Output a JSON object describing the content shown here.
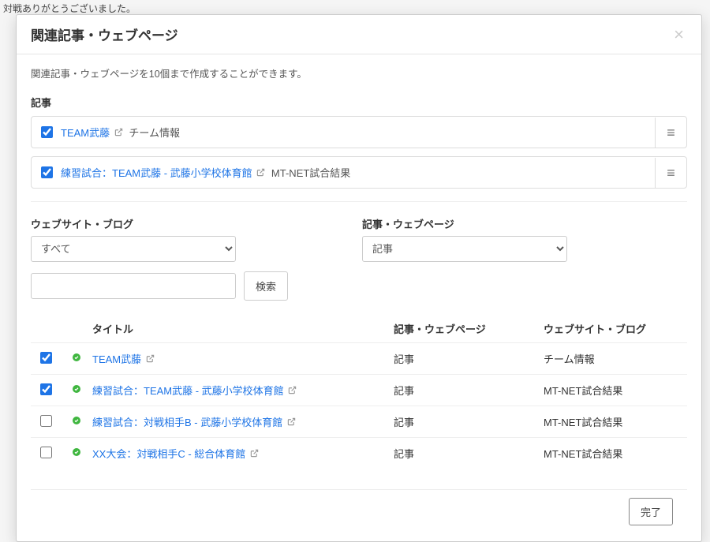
{
  "background": {
    "partial_text": "対戦ありがとうございました。"
  },
  "modal": {
    "title": "関連記事・ウェブページ",
    "close_aria": "Close",
    "intro": "関連記事・ウェブページを10個まで作成することができます。",
    "selected_label": "記事",
    "selected_items": [
      {
        "checked": true,
        "link": "TEAM武藤",
        "has_ext": true,
        "site": "チーム情報"
      },
      {
        "checked": true,
        "link": "練習試合：TEAM武藤 - 武藤小学校体育館",
        "has_ext": true,
        "site": "MT-NET試合結果"
      }
    ],
    "filters": {
      "website_label": "ウェブサイト・ブログ",
      "website_value": "すべて",
      "type_label": "記事・ウェブページ",
      "type_value": "記事"
    },
    "search": {
      "placeholder": "",
      "button": "検索"
    },
    "table": {
      "head": {
        "title": "タイトル",
        "type": "記事・ウェブページ",
        "site": "ウェブサイト・ブログ"
      },
      "rows": [
        {
          "checked": true,
          "status": "published",
          "title": "TEAM武藤",
          "has_ext": true,
          "type": "記事",
          "site": "チーム情報"
        },
        {
          "checked": true,
          "status": "published",
          "title": "練習試合：TEAM武藤 - 武藤小学校体育館",
          "has_ext": true,
          "type": "記事",
          "site": "MT-NET試合結果"
        },
        {
          "checked": false,
          "status": "published",
          "title": "練習試合：対戦相手B - 武藤小学校体育館",
          "has_ext": true,
          "type": "記事",
          "site": "MT-NET試合結果"
        },
        {
          "checked": false,
          "status": "published",
          "title": "XX大会：対戦相手C - 総合体育館",
          "has_ext": true,
          "type": "記事",
          "site": "MT-NET試合結果"
        }
      ]
    },
    "footer": {
      "done": "完了"
    }
  }
}
